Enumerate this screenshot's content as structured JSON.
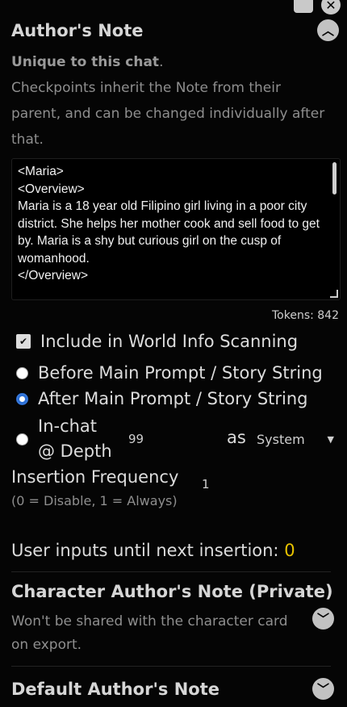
{
  "colors": {
    "accent_yellow": "#e8c300",
    "radio_blue": "#2b6fd6",
    "muted": "#8e8e8e"
  },
  "icons": {
    "top_left": "panel-icon",
    "top_right": "close-icon",
    "collapse": "chevron-up-icon",
    "expand": "chevron-down-icon"
  },
  "authors_note": {
    "title": "Author's Note",
    "unique_label": "Unique to this chat",
    "unique_period": ".",
    "description": "Checkpoints inherit the Note from their parent, and can be changed individually after that.",
    "textarea_value": "<Maria>\n<Overview>\nMaria is a 18 year old Filipino girl living in a poor city district. She helps her mother cook and sell food to get by. Maria is a shy but curious girl on the cusp of womanhood.\n</Overview>",
    "tokens_label": "Tokens: 842",
    "include_world_info": {
      "label": "Include in World Info Scanning",
      "checked": true
    },
    "position_options": [
      {
        "label": "Before Main Prompt / Story String",
        "checked": false
      },
      {
        "label": "After Main Prompt / Story String",
        "checked": true
      },
      {
        "label_line1": "In-chat",
        "label_line2": "@ Depth",
        "checked": false
      }
    ],
    "depth_value": "99",
    "as_label": "as",
    "role_select": "System",
    "frequency_title": "Insertion Frequency",
    "frequency_value": "1",
    "frequency_hint": "(0 = Disable, 1 = Always)",
    "user_inputs_label": "User inputs until next insertion:",
    "user_inputs_count": "0"
  },
  "character_note": {
    "title": "Character Author's Note (Private)",
    "description": "Won't be shared with the character card on export."
  },
  "default_note": {
    "title": "Default Author's Note"
  }
}
